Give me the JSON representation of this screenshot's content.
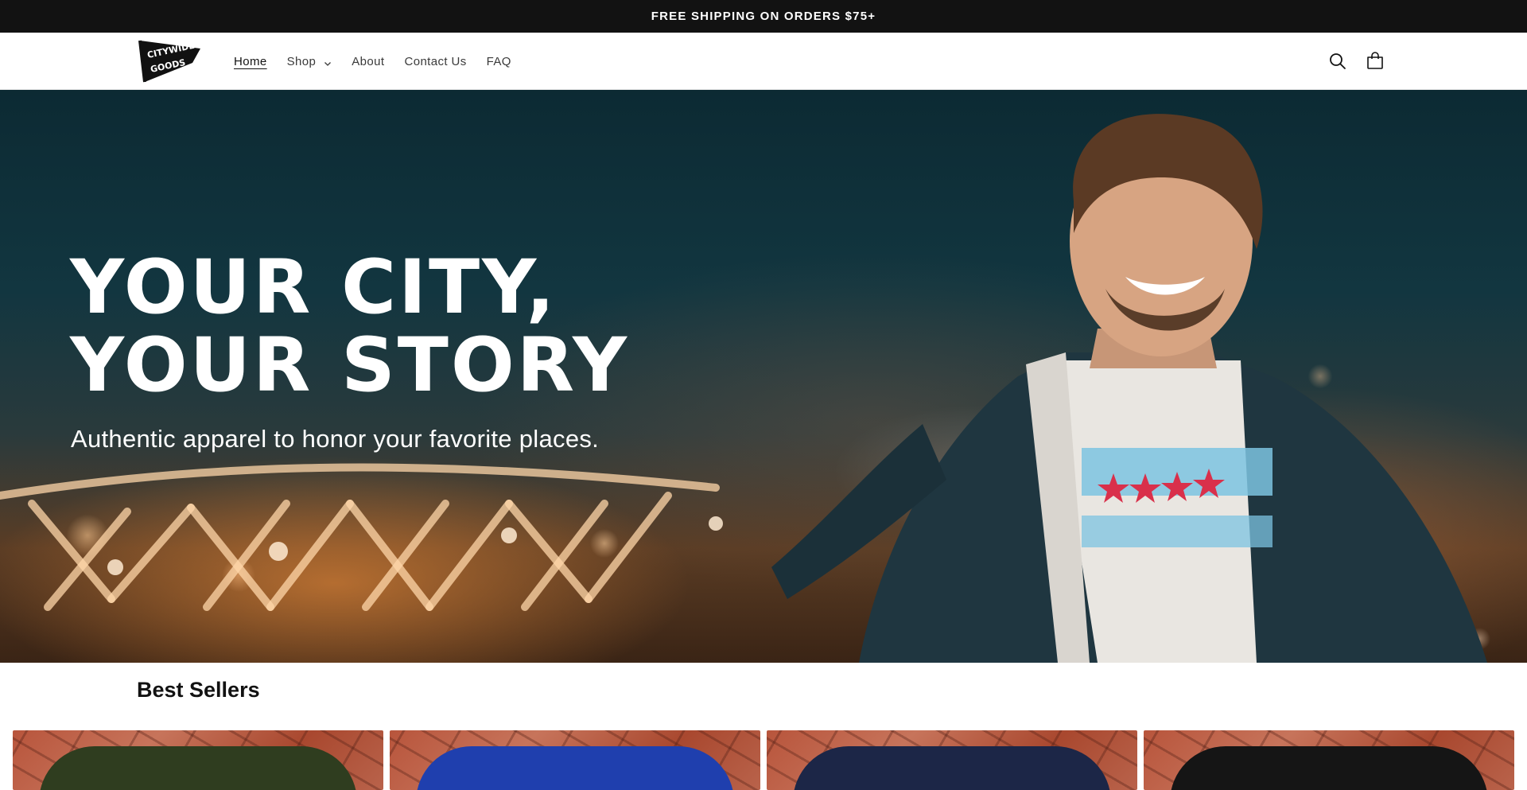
{
  "announcement": {
    "text": "FREE SHIPPING ON ORDERS $75+"
  },
  "header": {
    "logo": {
      "text_line1": "CITYWIDE",
      "text_line2": "GOODS"
    },
    "nav": [
      {
        "label": "Home",
        "active": true
      },
      {
        "label": "Shop",
        "has_dropdown": true
      },
      {
        "label": "About"
      },
      {
        "label": "Contact Us"
      },
      {
        "label": "FAQ"
      }
    ],
    "icons": {
      "search": "search-icon",
      "cart": "cart-icon"
    }
  },
  "hero": {
    "title_line1": "YOUR CITY,",
    "title_line2": "YOUR STORY",
    "subtitle": "Authentic apparel to honor your favorite places."
  },
  "best_sellers": {
    "title": "Best Sellers",
    "products": [
      {
        "shirt_color": "#2f3d1f"
      },
      {
        "shirt_color": "#1f3fae"
      },
      {
        "shirt_color": "#1c2647"
      },
      {
        "shirt_color": "#151515"
      }
    ]
  },
  "colors": {
    "announcement_bg": "#121212",
    "accent_text": "#121212"
  }
}
